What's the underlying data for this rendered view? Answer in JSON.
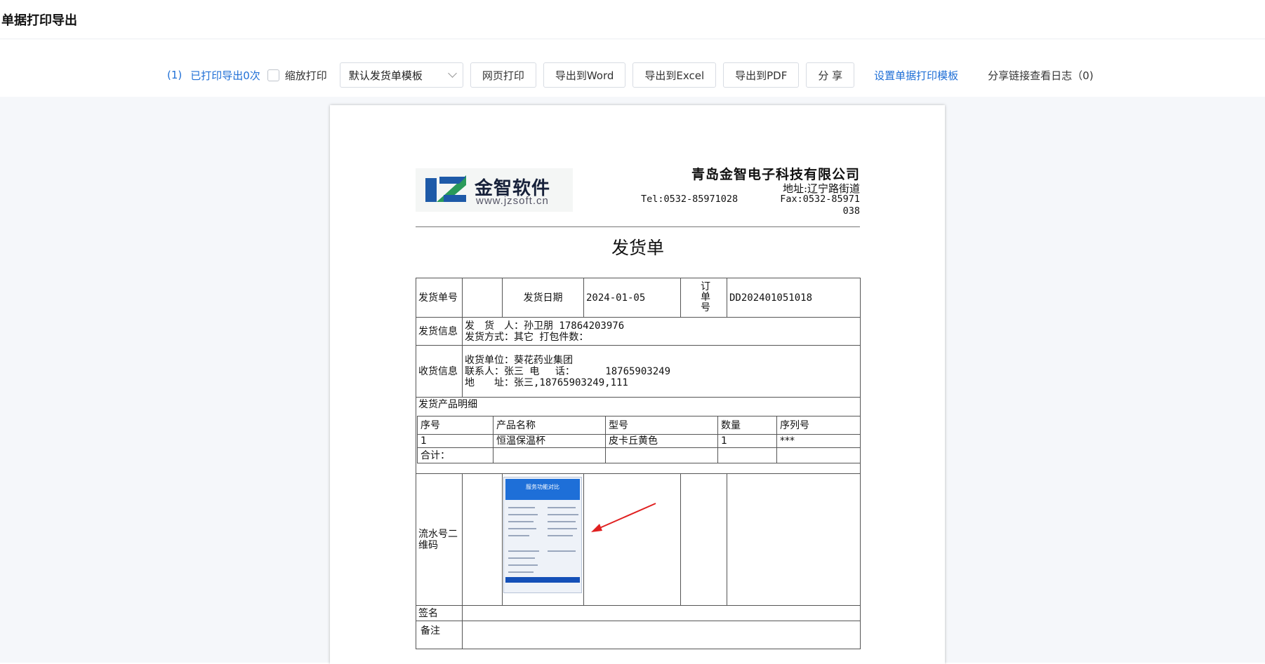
{
  "page": {
    "title": "单据打印导出"
  },
  "toolbar": {
    "count_label": "(1)",
    "printed_label": "已打印导出0次",
    "zoom_print_label": "缩放打印",
    "zoom_print_checked": false,
    "template_select": "默认发货单模板",
    "web_print": "网页打印",
    "export_word": "导出到Word",
    "export_excel": "导出到Excel",
    "export_pdf": "导出到PDF",
    "share": "分 享",
    "set_template": "设置单据打印模板",
    "share_log": "分享链接查看日志（0)"
  },
  "document": {
    "logo": {
      "cn": "金智软件",
      "url": "www.jzsoft.cn"
    },
    "company": "青岛金智电子科技有限公司",
    "address": "地址:辽宁路街道",
    "tel": "Tel:0532-85971028",
    "fax": "Fax:0532-85971038",
    "title": "发货单",
    "row1": {
      "no_label": "发货单号",
      "no_value": "",
      "date_label": "发货日期",
      "date_value": "2024-01-05",
      "order_label": "订单号",
      "order_value": "DD202401051018"
    },
    "shipping": {
      "label": "发货信息",
      "line1": "发　货　人：孙卫朋 17864203976",
      "line2": "发货方式：其它 打包件数："
    },
    "receiving": {
      "label": "收货信息",
      "line1": "收货单位：葵花药业集团",
      "line2": "联系人：张三 电　 话：　　　 18765903249",
      "line3": "地　　址：张三,18765903249,111"
    },
    "products": {
      "label": "发货产品明细",
      "headers": [
        "序号",
        "产品名称",
        "型号",
        "数量",
        "序列号"
      ],
      "rows": [
        [
          "1",
          "恒温保温杯",
          "皮卡丘黄色",
          "1",
          "***"
        ]
      ],
      "total_label": "合计："
    },
    "qr_label": "流水号二维码",
    "qr_image_title": "服务功能对比",
    "sign_label": "签名",
    "remark_label": "备注"
  },
  "colors": {
    "accent": "#1f6fd6",
    "arrow": "#e02020",
    "logo_blue": "#1e5aa8",
    "logo_green": "#2a9a5a"
  }
}
